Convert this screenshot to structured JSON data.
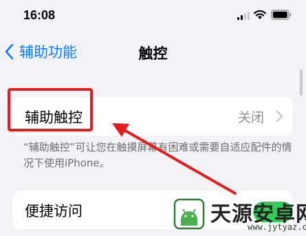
{
  "status_bar": {
    "time": "16:08",
    "signal_icon": "cellular-signal-icon",
    "wifi_icon": "wifi-icon",
    "battery_icon": "battery-icon"
  },
  "nav": {
    "back_label": "辅助功能",
    "back_icon": "chevron-left-icon",
    "title": "触控"
  },
  "assistive_touch": {
    "label": "辅助触控",
    "value": "关闭",
    "icon": "chevron-right-icon"
  },
  "footnote": "“辅助触控”可让您在触摸屏幕有困难或需要自适应配件的情况下使用iPhone。",
  "shortcut_row": {
    "label": "便捷访问"
  },
  "annotation": {
    "color": "#e31d1d"
  },
  "watermark": {
    "title": "天源安卓网",
    "url": "www.jytyaz.com",
    "logo": "android-logo-icon"
  },
  "colors": {
    "accent": "#0a7aff",
    "background": "#f2f2f7",
    "toggle_on": "#34c759"
  }
}
